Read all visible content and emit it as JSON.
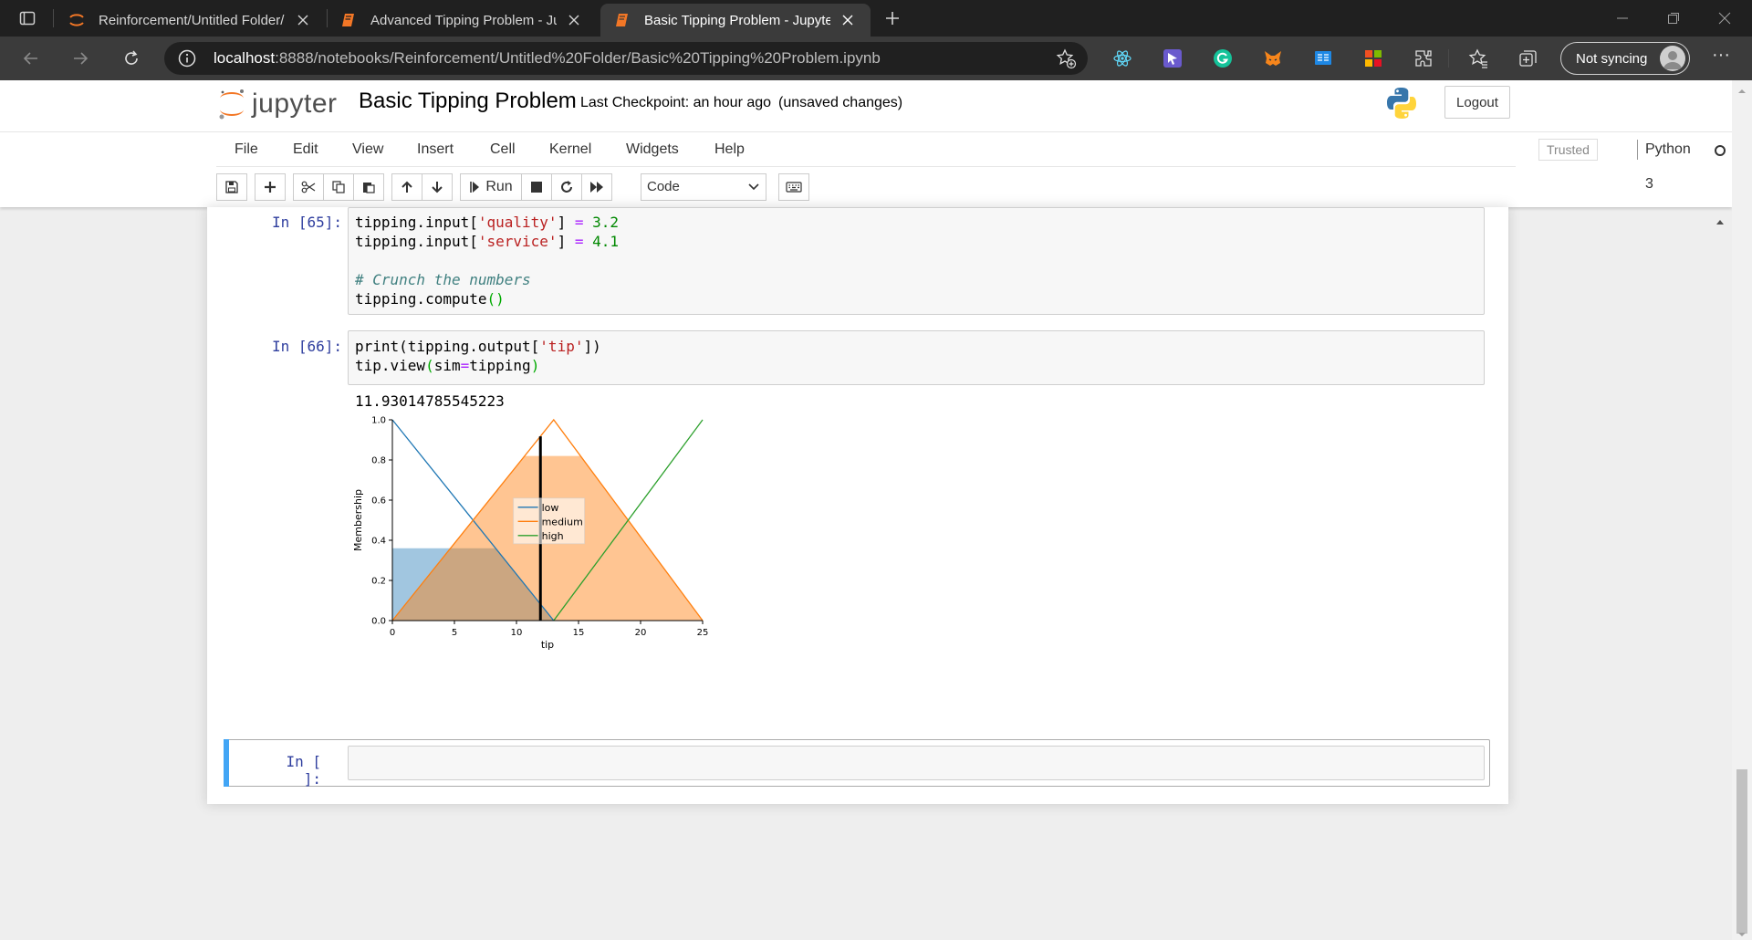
{
  "browser": {
    "tabs": [
      {
        "title": "Reinforcement/Untitled Folder/",
        "icon": "jupyter-icon"
      },
      {
        "title": "Advanced Tipping Problem - Jup",
        "icon": "notebook-icon"
      },
      {
        "title": "Basic Tipping Problem - Jupyter",
        "icon": "notebook-icon"
      }
    ],
    "url_host": "localhost",
    "url_rest": ":8888/notebooks/Reinforcement/Untitled%20Folder/Basic%20Tipping%20Problem.ipynb",
    "sync_label": "Not syncing",
    "more_label": "···",
    "colors": {
      "tabbar": "#202020",
      "addrbar": "#3b3b3b",
      "omnibox": "#202020"
    }
  },
  "jupyter": {
    "logo_text": "jupyter",
    "notebook_title": "Basic Tipping Problem",
    "checkpoint": "Last Checkpoint: an hour ago",
    "unsaved": "(unsaved changes)",
    "logout": "Logout",
    "menu": [
      "File",
      "Edit",
      "View",
      "Insert",
      "Cell",
      "Kernel",
      "Widgets",
      "Help"
    ],
    "trusted": "Trusted",
    "kernel": "Python 3",
    "run_label": "Run",
    "cell_type": "Code",
    "accent": "#42a5f5",
    "prompt_color": "#303f9f"
  },
  "cells": {
    "c65": {
      "prompt": "In [65]:",
      "l1a": "tipping.input[",
      "l1s": "'quality'",
      "l1b": "] ",
      "l1op": "=",
      "l1n": " 3.2",
      "l2a": "tipping.input[",
      "l2s": "'service'",
      "l2b": "] ",
      "l2op": "=",
      "l2n": " 4.1",
      "l4": "# Crunch the numbers",
      "l5a": "tipping.compute",
      "l5p": "()"
    },
    "c66": {
      "prompt": "In [66]:",
      "l1a": "print(tipping.output[",
      "l1s": "'tip'",
      "l1b": "])",
      "l2a": "tip.view",
      "l2p": "(",
      "l2b": "sim",
      "l2op": "=",
      "l2c": "tipping",
      "l2q": ")",
      "output": "11.93014785545223"
    },
    "empty": {
      "prompt": "In [ ]:"
    }
  },
  "chart_data": {
    "type": "line",
    "xlabel": "tip",
    "ylabel": "Membership",
    "xlim": [
      0,
      25
    ],
    "ylim": [
      0,
      1
    ],
    "xticks": [
      "0",
      "5",
      "10",
      "15",
      "20",
      "25"
    ],
    "yticks": [
      "0.0",
      "0.2",
      "0.4",
      "0.6",
      "0.8",
      "1.0"
    ],
    "series": [
      {
        "name": "low",
        "color": "#1f77b4",
        "x": [
          0,
          13
        ],
        "y": [
          1,
          0
        ]
      },
      {
        "name": "medium",
        "color": "#ff7f0e",
        "x": [
          0,
          13,
          25
        ],
        "y": [
          0,
          1,
          0
        ]
      },
      {
        "name": "high",
        "color": "#2ca02c",
        "x": [
          13,
          25
        ],
        "y": [
          0,
          1
        ]
      }
    ],
    "activation_low": 0.36,
    "activation_medium": 0.82,
    "result_x": 11.93,
    "legend": "center"
  }
}
